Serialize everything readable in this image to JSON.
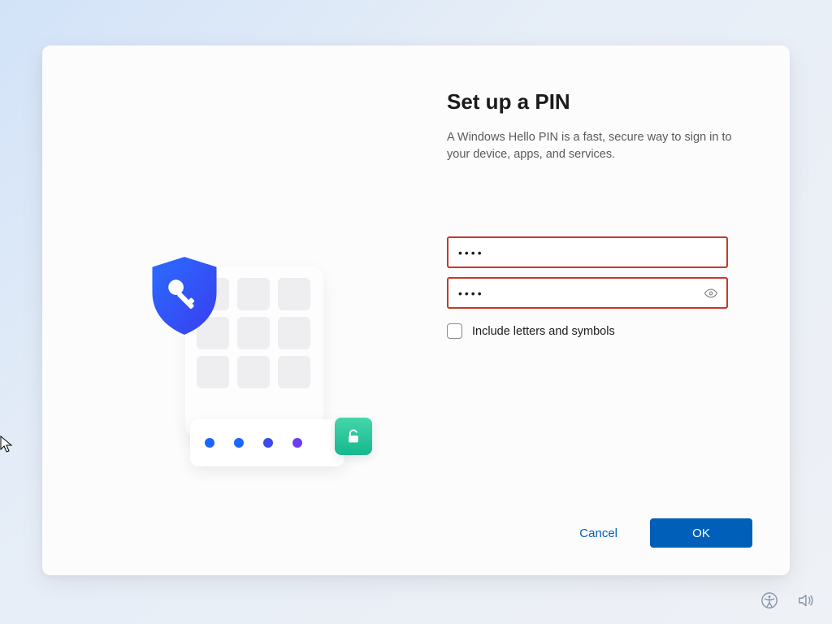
{
  "header": {
    "title": "Set up a PIN",
    "subtitle": "A Windows Hello PIN is a fast, secure way to sign in to your device, apps, and services."
  },
  "form": {
    "pin_value": "••••",
    "confirm_value": "••••",
    "include_label": "Include letters and symbols",
    "include_checked": false
  },
  "footer": {
    "cancel_label": "Cancel",
    "ok_label": "OK"
  },
  "colors": {
    "accent": "#005fb8",
    "error_border": "#c43a2b"
  },
  "icons": {
    "shield": "shield-key-icon",
    "unlock": "unlock-icon",
    "reveal": "eye-reveal-icon",
    "accessibility": "accessibility-icon",
    "volume": "volume-icon"
  }
}
